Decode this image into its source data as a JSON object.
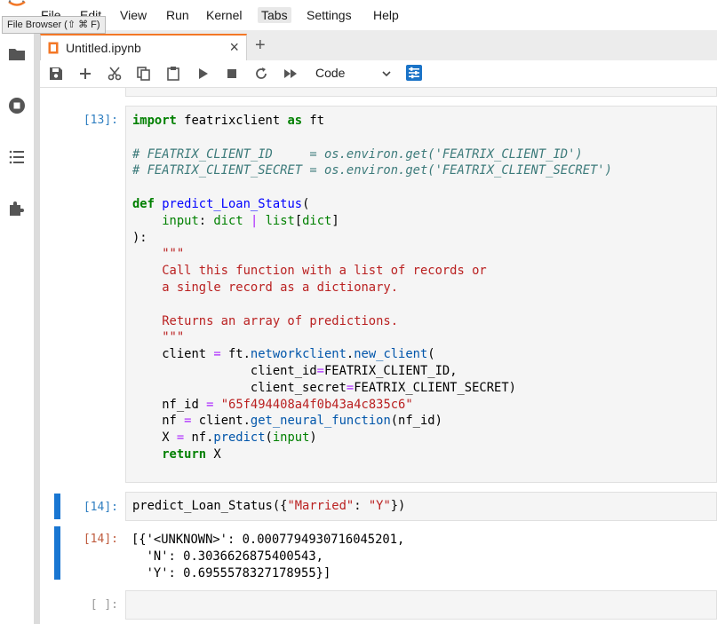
{
  "menubar": {
    "items": [
      "File",
      "Edit",
      "View",
      "Run",
      "Kernel",
      "Tabs",
      "Settings",
      "Help"
    ],
    "tooltip": "File Browser (⇧ ⌘ F)"
  },
  "dock": {
    "tab_title": "Untitled.ipynb",
    "close_glyph": "×",
    "new_tab_glyph": "+"
  },
  "toolbar": {
    "cell_type": "Code"
  },
  "cells": [
    {
      "prompt": "[13]:",
      "lines": [
        "import featrixclient as ft",
        "",
        "# FEATRIX_CLIENT_ID     = os.environ.get('FEATRIX_CLIENT_ID')",
        "# FEATRIX_CLIENT_SECRET = os.environ.get('FEATRIX_CLIENT_SECRET')",
        "",
        "def predict_Loan_Status(",
        "    input: dict | list[dict]",
        "):",
        "    \"\"\"",
        "    Call this function with a list of records or",
        "    a single record as a dictionary.",
        "",
        "    Returns an array of predictions.",
        "    \"\"\"",
        "    client = ft.networkclient.new_client(",
        "                client_id=FEATRIX_CLIENT_ID,",
        "                client_secret=FEATRIX_CLIENT_SECRET)",
        "    nf_id = \"65f494408a4f0b43a4c835c6\"",
        "    nf = client.get_neural_function(nf_id)",
        "    X = nf.predict(input)",
        "    return X"
      ]
    },
    {
      "prompt": "[14]:",
      "lines": [
        "predict_Loan_Status({\"Married\": \"Y\"})"
      ],
      "output_prompt": "[14]:",
      "output_lines": [
        "[{'<UNKNOWN>': 0.0007794930716045201,",
        "  'N': 0.3036626875400543,",
        "  'Y': 0.6955578327178955}]"
      ]
    },
    {
      "prompt": "[ ]:",
      "lines": []
    }
  ],
  "colors": {
    "accent_tab": "#f37726",
    "active_cell": "#1976d2",
    "in_prompt": "#307fc1",
    "out_prompt": "#bf5b3d"
  },
  "icons": [
    "jupyter-logo-icon",
    "folder-icon",
    "running-icon",
    "toc-icon",
    "extension-icon",
    "notebook-icon",
    "save-icon",
    "add-icon",
    "cut-icon",
    "copy-icon",
    "paste-icon",
    "run-icon",
    "stop-icon",
    "restart-icon",
    "fast-forward-icon",
    "chevron-down-icon",
    "property-inspector-icon"
  ]
}
